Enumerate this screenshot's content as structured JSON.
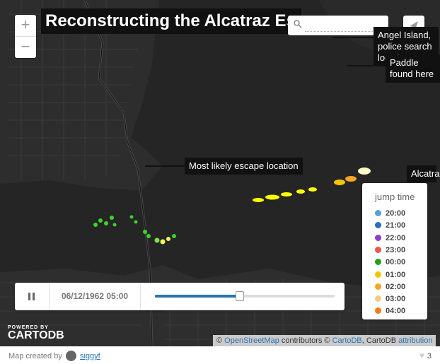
{
  "map": {
    "title": "Reconstructing the Alcatraz Escape"
  },
  "controls": {
    "zoom_in": "+",
    "zoom_out": "−",
    "search_placeholder": "",
    "share_icon": "paper-plane-icon",
    "search_icon": "magnifier-icon"
  },
  "annotations": {
    "police": "Angel Island, police search location",
    "paddle": "Paddle found here",
    "escape": "Most likely escape location",
    "alcatraz": "Alcatraz"
  },
  "legend": {
    "title": "jump time",
    "items": [
      {
        "label": "20:00",
        "color": "#5b9fd6"
      },
      {
        "label": "21:00",
        "color": "#2e6fb0"
      },
      {
        "label": "22:00",
        "color": "#8e3fc6"
      },
      {
        "label": "23:00",
        "color": "#e8554c"
      },
      {
        "label": "00:00",
        "color": "#2a9c1e"
      },
      {
        "label": "01:00",
        "color": "#f5c400"
      },
      {
        "label": "02:00",
        "color": "#f5a623"
      },
      {
        "label": "03:00",
        "color": "#f7c98b"
      },
      {
        "label": "04:00",
        "color": "#f07b1f"
      }
    ]
  },
  "timeline": {
    "date": "06/12/1962 05:00",
    "progress": 0.47,
    "pause_icon": "pause-icon"
  },
  "branding": {
    "powered": "POWERED BY",
    "logo": "CARTODB"
  },
  "attribution": {
    "prefix": "©",
    "osm": "OpenStreetMap",
    "mid": "contributors ©",
    "cartodb": "CartoDB",
    "mid2": ", CartoDB",
    "attribution": "attribution"
  },
  "footer": {
    "created_by": "Map created by",
    "username": "siggyf",
    "likes": "3",
    "heart_icon": "heart-icon"
  }
}
